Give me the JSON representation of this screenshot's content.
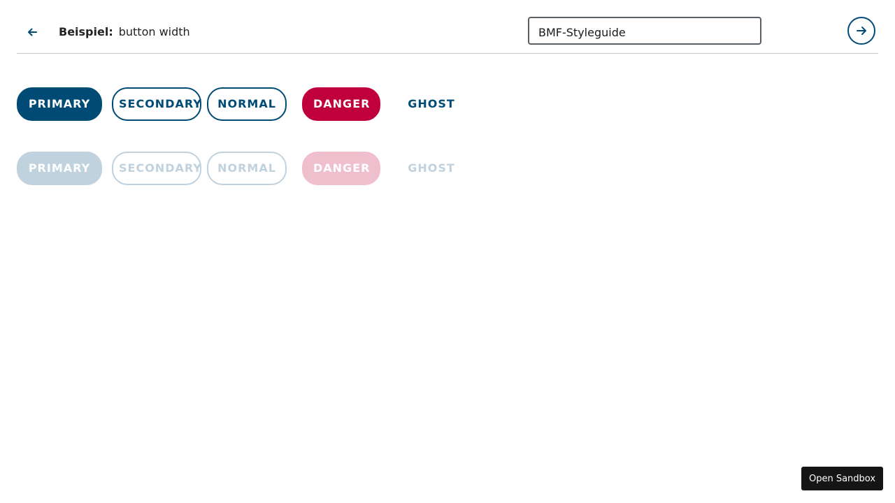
{
  "header": {
    "title_label": "Beispiel:",
    "title_value": "button width",
    "styleguide_value": "BMF-Styleguide",
    "back_icon": "arrow-left-icon",
    "next_icon": "arrow-right-icon"
  },
  "buttons_enabled": {
    "primary": "PRIMARY",
    "secondary": "SECONDARY",
    "normal": "NORMAL",
    "danger": "DANGER",
    "ghost": "GHOST"
  },
  "buttons_disabled": {
    "primary": "PRIMARY",
    "secondary": "SECONDARY",
    "normal": "NORMAL",
    "danger": "DANGER",
    "ghost": "GHOST"
  },
  "sandbox": {
    "label": "Open Sandbox"
  },
  "colors": {
    "brand_blue": "#004b76",
    "danger_red": "#c0003c",
    "disabled_blue": "#bfd2de",
    "disabled_red": "#f0bfce"
  }
}
